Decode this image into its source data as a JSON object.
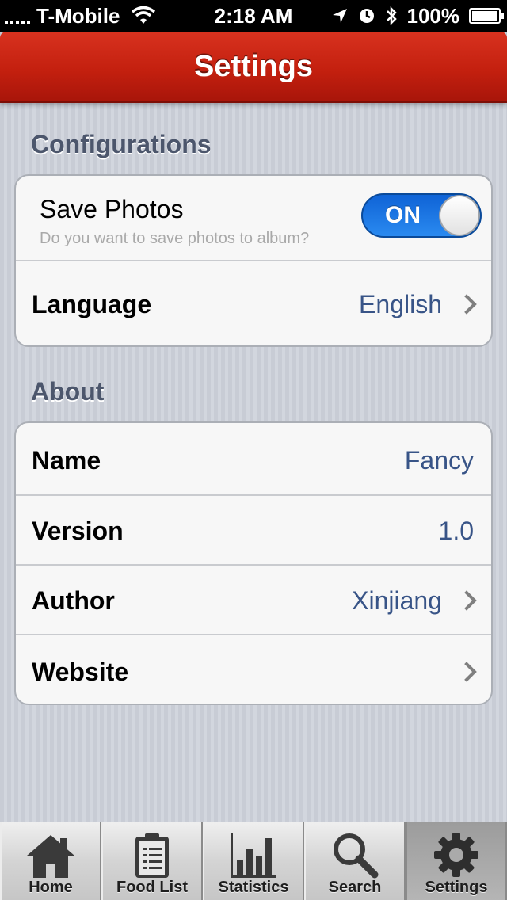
{
  "status_bar": {
    "carrier": "T-Mobile",
    "time": "2:18 AM",
    "battery": "100%"
  },
  "nav": {
    "title": "Settings"
  },
  "sections": {
    "configurations": {
      "title": "Configurations",
      "save_photos": {
        "label": "Save Photos",
        "subtitle": "Do you want to save photos to album?",
        "toggle": "ON"
      },
      "language": {
        "label": "Language",
        "value": "English"
      }
    },
    "about": {
      "title": "About",
      "name": {
        "label": "Name",
        "value": "Fancy"
      },
      "version": {
        "label": "Version",
        "value": "1.0"
      },
      "author": {
        "label": "Author",
        "value": "Xinjiang"
      },
      "website": {
        "label": "Website"
      }
    }
  },
  "tabs": [
    {
      "label": "Home",
      "icon": "home-icon"
    },
    {
      "label": "Food List",
      "icon": "clipboard-icon"
    },
    {
      "label": "Statistics",
      "icon": "bar-chart-icon"
    },
    {
      "label": "Search",
      "icon": "search-icon"
    },
    {
      "label": "Settings",
      "icon": "gear-icon",
      "active": true
    }
  ],
  "colors": {
    "nav_red": "#c4200f",
    "value_blue": "#385487",
    "toggle_blue": "#1a73e2"
  }
}
